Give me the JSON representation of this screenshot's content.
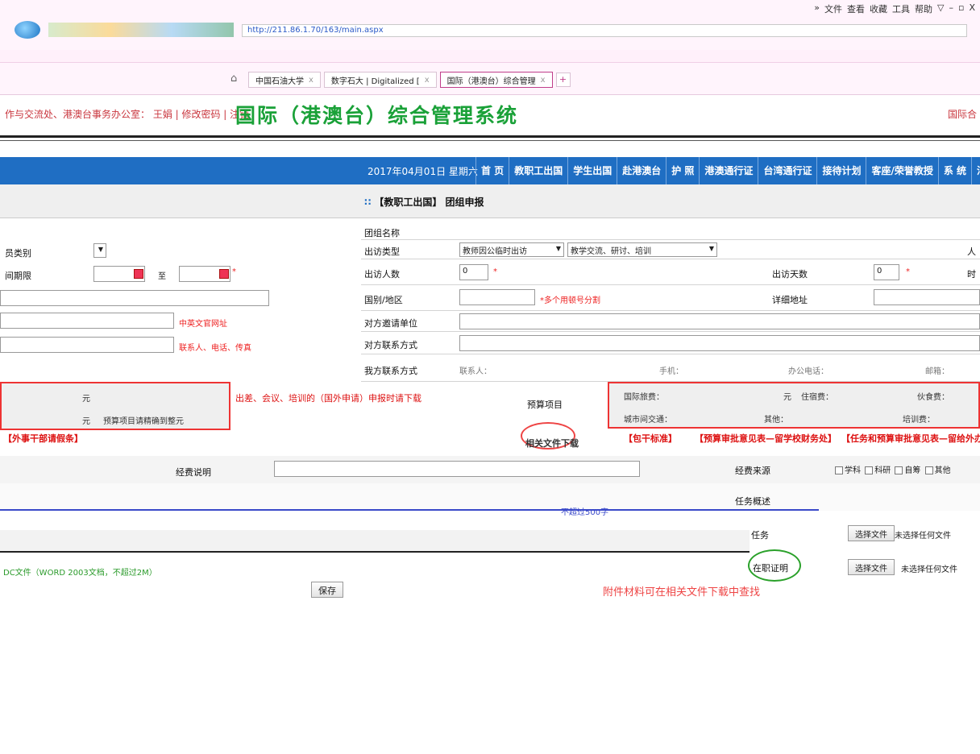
{
  "browser": {
    "menu": [
      "»",
      "文件",
      "查看",
      "收藏",
      "工具",
      "帮助",
      "▽",
      "–",
      "▫",
      "X"
    ],
    "address": "http://211.86.1.70/163/main.aspx",
    "tabs": [
      {
        "label": "中国石油大学",
        "active": false
      },
      {
        "label": "数字石大 | Digitalized [",
        "active": false
      },
      {
        "label": "国际（港澳台）综合管理",
        "active": true
      }
    ]
  },
  "header": {
    "user_line": "作与交流处、港澳台事务办公室： 王娟 | 修改密码 | 注销",
    "system_name": "国际（港澳台）综合管理系统",
    "right_link": "国际合"
  },
  "nav": {
    "date": "2017年04月01日 星期六",
    "items": [
      "首 页",
      "教职工出国",
      "学生出国",
      "赴港澳台",
      "护 照",
      "港澳通行证",
      "台湾通行证",
      "接待计划",
      "客座/荣誉教授",
      "系 统",
      "消息收发"
    ]
  },
  "breadcrumb": "【教职工出国】 团组申报",
  "form": {
    "group_name_label": "团组名称",
    "visit_type_label": "出访类型",
    "visit_type_value": "教师因公临时出访",
    "visit_sub_value": "教学交流、研讨、培训",
    "people_label_right": "人",
    "visitors_label": "出访人数",
    "visitors_value": "0",
    "days_label": "出访天数",
    "days_value": "0",
    "time_label_right": "时",
    "country_label": "国别/地区",
    "country_note": "*多个用顿号分割",
    "address_label": "详细地址",
    "inviter_label": "对方邀请单位",
    "contact_label": "对方联系方式",
    "our_contact_label": "我方联系方式",
    "our_contact_person": "联系人：",
    "our_contact_phone": "手机：",
    "our_contact_tel": "办公电话：",
    "our_contact_email": "邮箱：",
    "budget_label": "预算项目",
    "related_files": "相关文件下载",
    "funds_label": "经费说明",
    "funds_source_label": "经费来源",
    "funds_source_options": [
      "学科",
      "科研",
      "自筹",
      "其他"
    ],
    "task_label": "任务概述",
    "task_hint": "不超过500字",
    "upload_label": "任务",
    "invite_label": "在职证明",
    "choose_file_1": "选择文件",
    "file_status_1": "未选择任何文件",
    "choose_file_2": "选择文件",
    "file_status_2": "未选择任何文件",
    "save_button": "保存",
    "attachment_note": "附件材料可在相关文件下载中查找",
    "word_note": "DC文件（WORD 2003文档，不超过2M）"
  },
  "left_pane": {
    "category_label": "员类别",
    "period_label": "间期限",
    "period_to": "至",
    "site_label": "中英文官网址",
    "contact_note": "联系人、电话、传真",
    "budget_unit_1": "元",
    "budget_unit_2": "元",
    "budget_note": "预算项目请精确到整元",
    "foreign_dept": "【外事干部请假条】",
    "red_note": "出差、会议、培训的（国外申请）申报时请下载"
  },
  "budget_right": {
    "international_fee": "国际旅费：",
    "hotel_fee": "住宿费：",
    "meal_fee": "伙食费：",
    "local_fee": "城市间交通：",
    "misc_fee": "其他：",
    "training_fee": "培训费：",
    "unit": "元",
    "links": [
      "【包干标准】",
      "【预算审批意见表—留学校财务处】",
      "【任务和预算审批意见表—留给外办】"
    ]
  }
}
